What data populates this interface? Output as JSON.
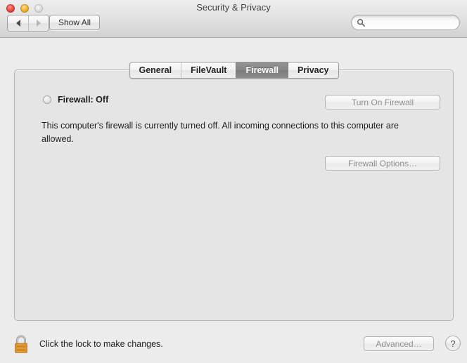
{
  "window": {
    "title": "Security & Privacy",
    "traffic_lights": [
      {
        "name": "close",
        "color": "#f0544a",
        "enabled": true
      },
      {
        "name": "minimize",
        "color": "#f5b93c",
        "enabled": true
      },
      {
        "name": "zoom",
        "color": "#e3e3e3",
        "enabled": false
      }
    ]
  },
  "toolbar": {
    "back_icon": "triangle-left-icon",
    "forward_icon": "triangle-right-icon",
    "back_enabled": true,
    "forward_enabled": false,
    "show_all_label": "Show All",
    "search": {
      "icon": "search-icon",
      "value": "",
      "placeholder": ""
    }
  },
  "tabs": [
    {
      "id": "general",
      "label": "General",
      "selected": false
    },
    {
      "id": "filevault",
      "label": "FileVault",
      "selected": false
    },
    {
      "id": "firewall",
      "label": "Firewall",
      "selected": true
    },
    {
      "id": "privacy",
      "label": "Privacy",
      "selected": false
    }
  ],
  "firewall_panel": {
    "status_indicator": "status-circle-off-icon",
    "status_label": "Firewall: Off",
    "description": "This computer's firewall is currently turned off. All incoming connections to this computer are allowed.",
    "turn_on_button": {
      "label": "Turn On Firewall",
      "enabled": false
    },
    "options_button": {
      "label": "Firewall Options…",
      "enabled": false
    }
  },
  "footer": {
    "lock_icon": "lock-closed-icon",
    "lock_label": "Click the lock to make changes.",
    "advanced_button": {
      "label": "Advanced…",
      "enabled": false
    },
    "help_button": {
      "label": "?"
    }
  },
  "colors": {
    "window_background": "#ececec",
    "panel_background": "#e5e5e5",
    "selected_tab_background": "#878787",
    "lock_body": "#e0942f",
    "disabled_text": "#8b8b8b"
  }
}
